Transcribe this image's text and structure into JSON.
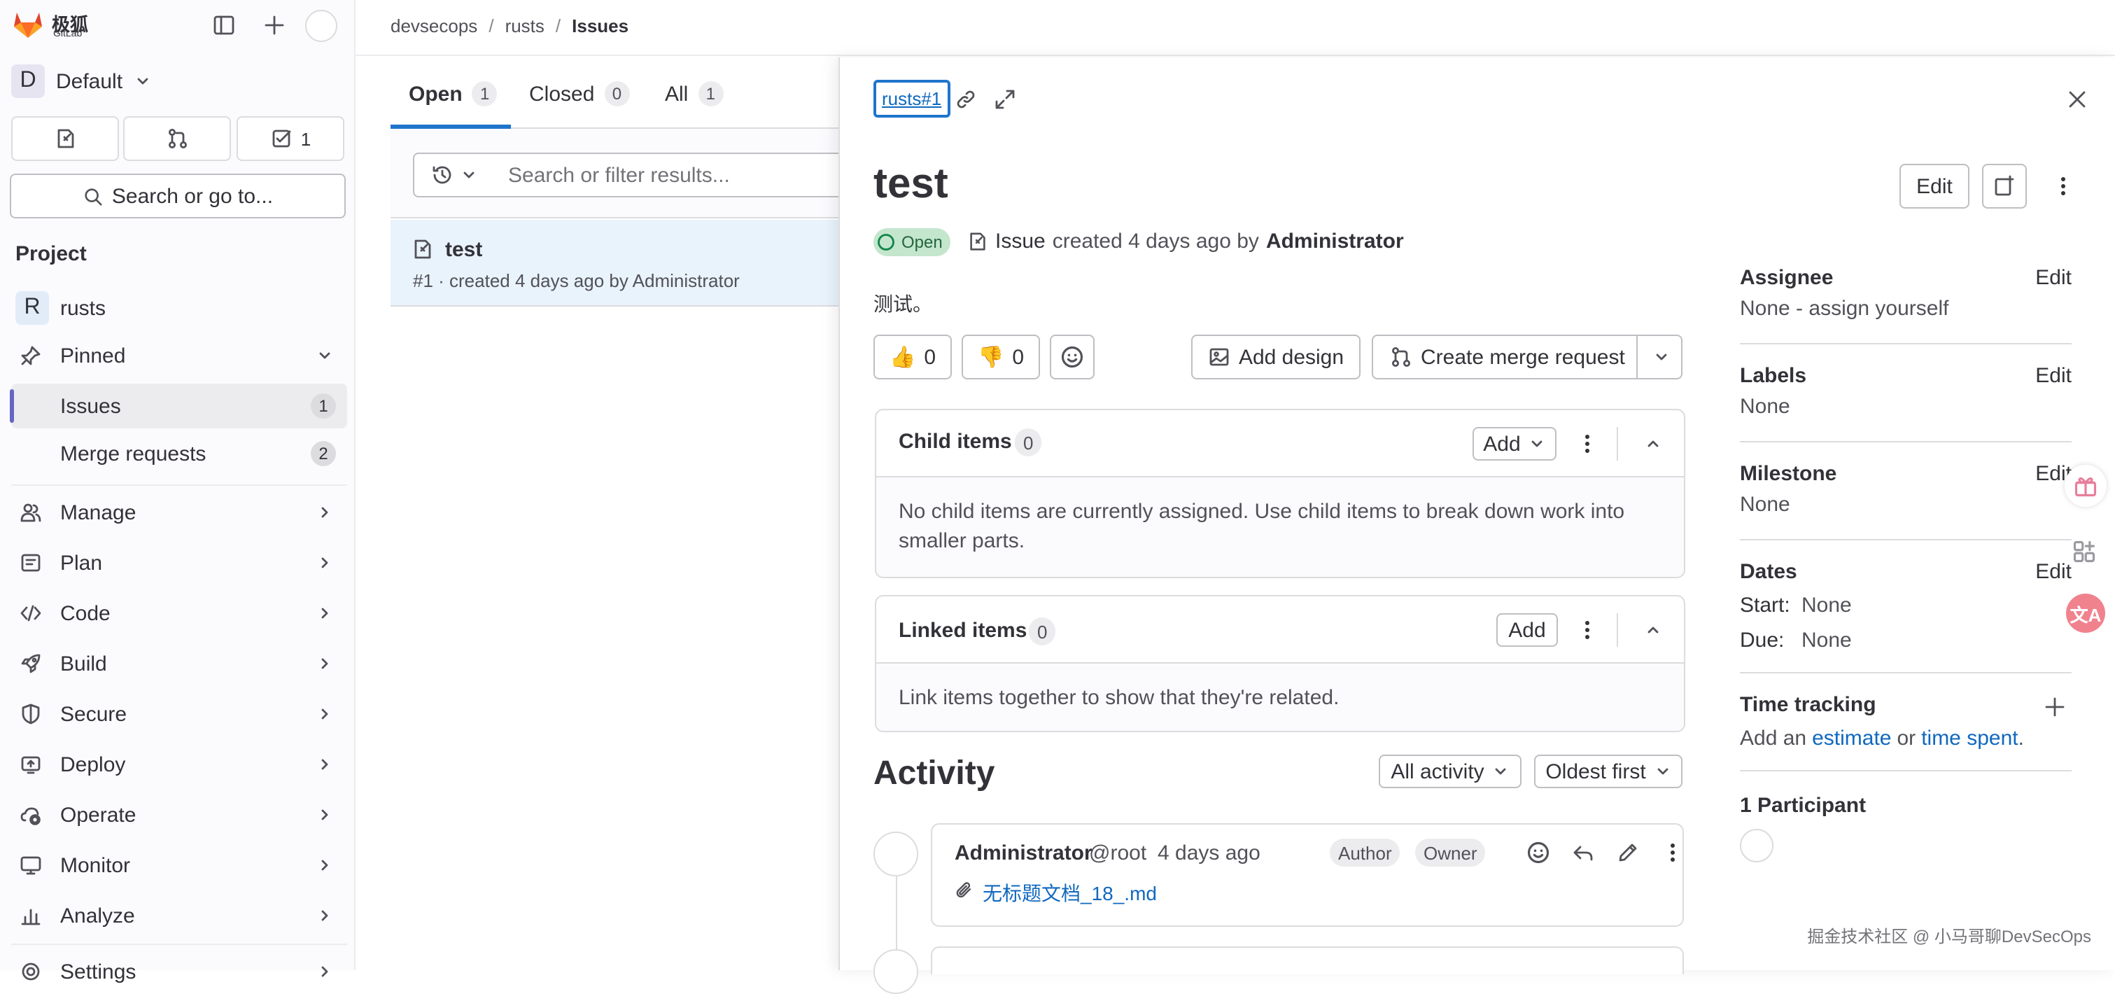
{
  "brand": {
    "logo_text": "极狐",
    "logo_sub": "GitLab"
  },
  "sidebar": {
    "group_initial": "D",
    "group_name": "Default",
    "todo_count": "1",
    "search_label": "Search or go to...",
    "section_title": "Project",
    "project_initial": "R",
    "project_name": "rusts",
    "pinned_label": "Pinned",
    "pinned_items": [
      {
        "label": "Issues",
        "count": "1"
      },
      {
        "label": "Merge requests",
        "count": "2"
      }
    ],
    "nav_items": [
      {
        "label": "Manage",
        "icon": "users-icon"
      },
      {
        "label": "Plan",
        "icon": "planning-icon"
      },
      {
        "label": "Code",
        "icon": "code-icon"
      },
      {
        "label": "Build",
        "icon": "rocket-icon"
      },
      {
        "label": "Secure",
        "icon": "shield-icon"
      },
      {
        "label": "Deploy",
        "icon": "deployments-icon"
      },
      {
        "label": "Operate",
        "icon": "cloud-gear-icon"
      },
      {
        "label": "Monitor",
        "icon": "monitor-icon"
      },
      {
        "label": "Analyze",
        "icon": "chart-icon"
      },
      {
        "label": "Settings",
        "icon": "settings-icon"
      }
    ]
  },
  "breadcrumb": {
    "items": [
      "devsecops",
      "rusts",
      "Issues"
    ]
  },
  "tabs": [
    {
      "label": "Open",
      "count": "1"
    },
    {
      "label": "Closed",
      "count": "0"
    },
    {
      "label": "All",
      "count": "1"
    }
  ],
  "filter": {
    "placeholder": "Search or filter results..."
  },
  "issue_list": [
    {
      "title": "test",
      "meta": "#1 · created 4 days ago by Administrator"
    }
  ],
  "drawer": {
    "reference": "rusts#1",
    "title": "test",
    "status": "Open",
    "type": "Issue",
    "created": "created 4 days ago by",
    "author": "Administrator",
    "edit_label": "Edit",
    "description": "测试。",
    "thumbs_up": "0",
    "thumbs_down": "0",
    "add_design_label": "Add design",
    "create_mr_label": "Create merge request",
    "child_items": {
      "title": "Child items",
      "count": "0",
      "add_label": "Add",
      "empty_text": "No child items are currently assigned. Use child items to break down work into smaller parts."
    },
    "linked_items": {
      "title": "Linked items",
      "count": "0",
      "add_label": "Add",
      "empty_text": "Link items together to show that they're related."
    },
    "activity": {
      "title": "Activity",
      "filter_label": "All activity",
      "sort_label": "Oldest first",
      "note": {
        "author": "Administrator",
        "username": "@root",
        "time": "4 days ago",
        "badge_author": "Author",
        "badge_owner": "Owner",
        "attachment": "无标题文档_18_.md"
      }
    },
    "sidebar": {
      "assignee_label": "Assignee",
      "assignee_value": "None - assign yourself",
      "labels_label": "Labels",
      "labels_value": "None",
      "milestone_label": "Milestone",
      "milestone_value": "None",
      "dates_label": "Dates",
      "start_label": "Start:",
      "start_value": "None",
      "due_label": "Due:",
      "due_value": "None",
      "time_tracking_label": "Time tracking",
      "time_pre": "Add an",
      "time_link1": "estimate",
      "time_mid": "or",
      "time_link2": "time spent",
      "time_post": ".",
      "participants_label": "1 Participant",
      "edit_label": "Edit"
    }
  },
  "watermark": "掘金技术社区 @ 小马哥聊DevSecOps",
  "colors": {
    "accent": "#1f75cb",
    "link": "#1068bf",
    "success": "#108548",
    "brand_orange": "#e24329",
    "active_bar": "#6666c4"
  }
}
